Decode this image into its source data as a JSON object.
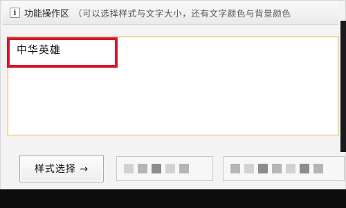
{
  "header": {
    "icon": "info-icon",
    "title": "功能操作区",
    "hint": "（可以选择样式与文字大小，还有文字颜色与背景颜色"
  },
  "editor": {
    "text": "中华英雄"
  },
  "toolbar": {
    "style_button_label": "样式选择 →"
  },
  "colors": {
    "highlight": "#d5182e",
    "editor_border": "#e6d19a"
  }
}
